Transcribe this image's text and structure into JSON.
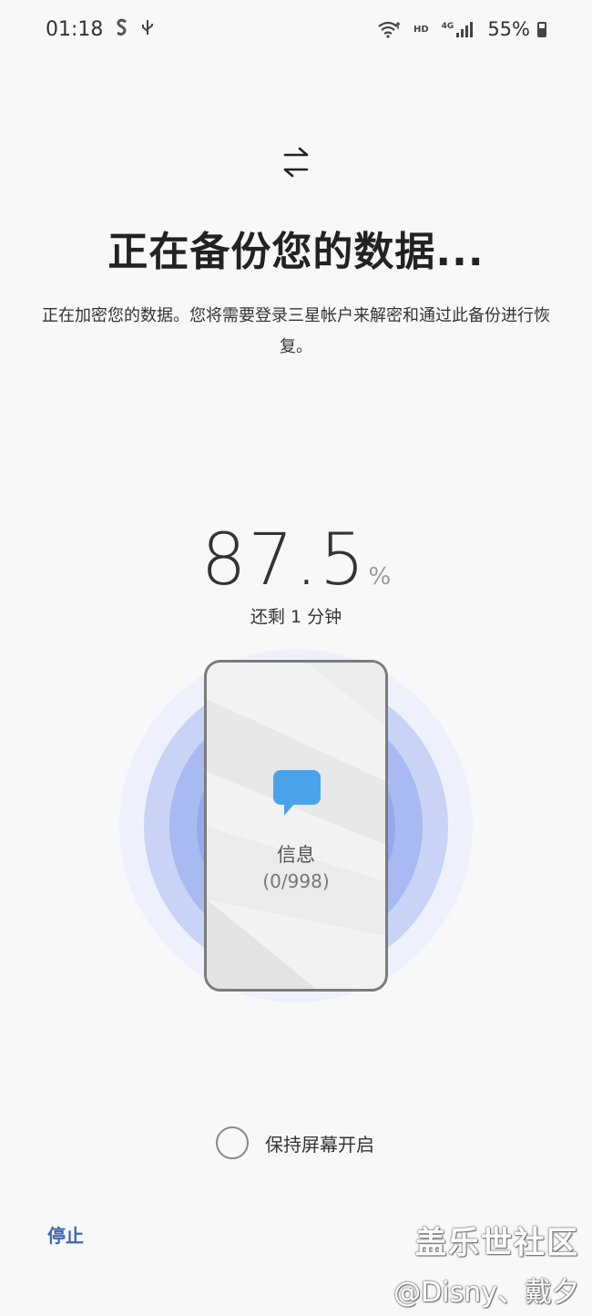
{
  "status_bar": {
    "time": "01:18",
    "icons_left": [
      "s-icon",
      "usb-icon"
    ],
    "hd_label": "HD",
    "network_label": "4G",
    "battery_percent": "55%"
  },
  "header": {
    "icon": "transfer-arrows-icon",
    "title": "正在备份您的数据...",
    "description": "正在加密您的数据。您将需要登录三星帐户来解密和通过此备份进行恢复。"
  },
  "progress": {
    "value": "87.5",
    "unit": "%",
    "time_remaining": "还剩 1 分钟"
  },
  "current_item": {
    "icon": "message-icon",
    "label": "信息",
    "count": "(0/998)"
  },
  "options": {
    "keep_screen_on_label": "保持屏幕开启",
    "keep_screen_on_checked": false
  },
  "actions": {
    "stop_label": "停止"
  },
  "watermark": {
    "line1": "盖乐世社区",
    "line2": "@Disny、戴夕"
  },
  "colors": {
    "accent": "#3a66b5",
    "message_icon": "#4aa3e8",
    "ring_outer": "#eef1fc",
    "ring_mid": "#c9d3f6",
    "ring_inner": "#96a9ef"
  }
}
